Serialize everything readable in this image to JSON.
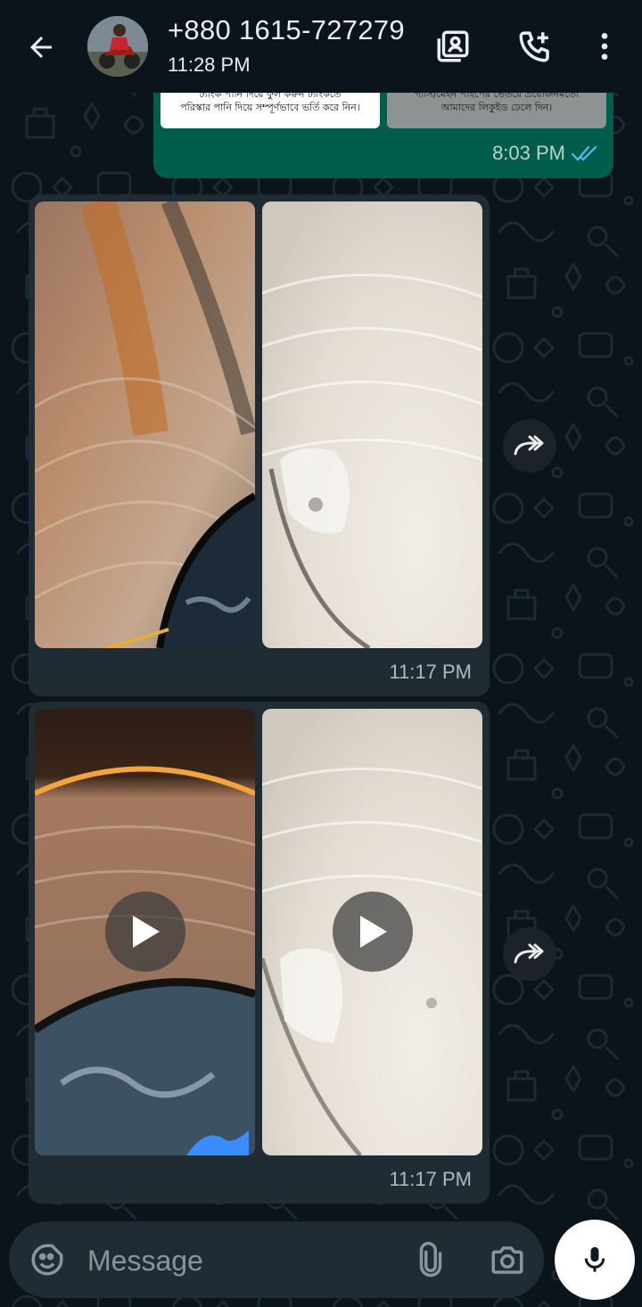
{
  "header": {
    "contact_name": "+880 1615-727279",
    "status": "11:28 PM",
    "icons": [
      "back-arrow-icon",
      "contact-card-icon",
      "add-call-icon",
      "more-vert-icon"
    ]
  },
  "messages": [
    {
      "type": "outgoing-card",
      "card_left_text": [
        "ট্যাংক পানি দিয়ে ফুল করুন ট্যাংকতে",
        "পরিস্কার পানি দিয়ে সম্পূর্ণভাবে ভর্তি করে নিন।"
      ],
      "card_right_text": [
        "গ্যাস/মেইন পাইপের ভেতরে প্রয়োজনমতো",
        "আমাদের লিকুইড ঢেলে দিন।"
      ],
      "time": "8:03 PM",
      "status": "read"
    },
    {
      "type": "incoming-images",
      "items": [
        "image",
        "image"
      ],
      "time": "11:17 PM"
    },
    {
      "type": "incoming-videos",
      "items": [
        "video",
        "video"
      ],
      "time": "11:17 PM"
    }
  ],
  "composer": {
    "placeholder": "Message",
    "icons": [
      "sticker-icon",
      "attach-icon",
      "camera-icon",
      "mic-icon"
    ]
  },
  "colors": {
    "background": "#0b141a",
    "outgoing_bubble": "#005c4b",
    "incoming_bubble": "#202c33",
    "read_ticks": "#53bdeb",
    "composer": "#1f2c33"
  }
}
